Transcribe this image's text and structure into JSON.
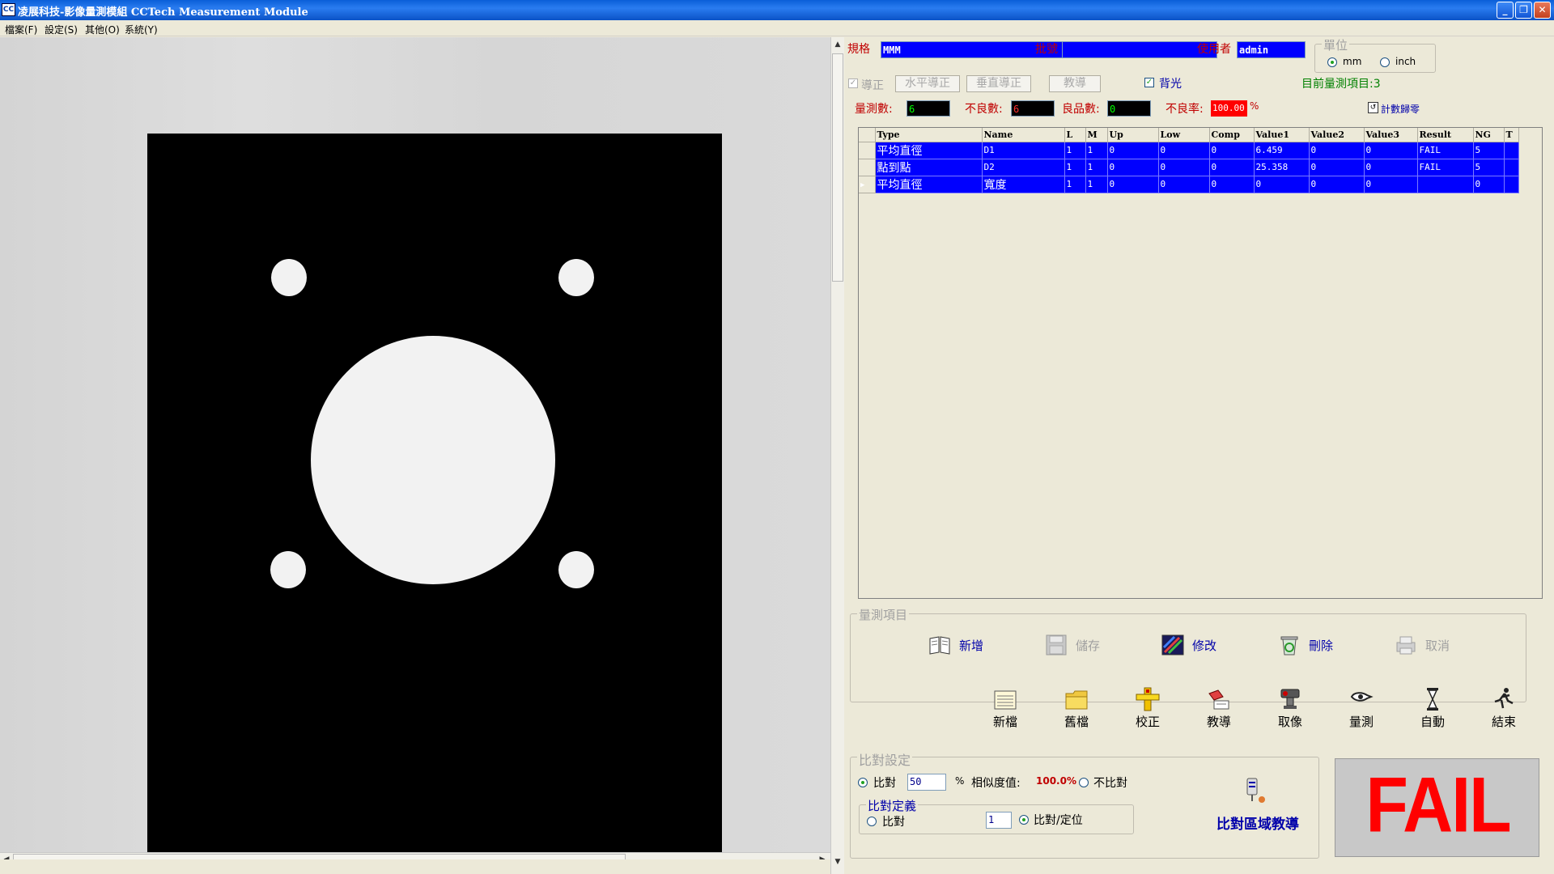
{
  "window": {
    "title": "凌展科技-影像量測模組 CCTech Measurement Module",
    "icon_text": "CC"
  },
  "menu": [
    "檔案(F)",
    "設定(S)",
    "其他(O)",
    "系統(Y)"
  ],
  "header": {
    "spec_label": "規格",
    "spec_value": "MMM",
    "batch_label": "批號",
    "batch_value": "",
    "user_label": "使用者",
    "user_value": "admin",
    "unit_group_title": "單位",
    "unit_mm": "mm",
    "unit_inch": "inch",
    "unit_selected": "mm"
  },
  "controls": {
    "guide_check_label": "導正",
    "horizontal_guide": "水平導正",
    "vertical_guide": "垂直導正",
    "teach": "教導",
    "backlight_label": "背光",
    "current_items": "目前量測項目:3"
  },
  "stats": {
    "measure_count_label": "量測數:",
    "measure_count": "6",
    "defect_count_label": "不良數:",
    "defect_count": "6",
    "good_count_label": "良品數:",
    "good_count": "0",
    "defect_rate_label": "不良率:",
    "defect_rate": "100.00",
    "percent": "%",
    "reset_label": "計數歸零"
  },
  "table": {
    "columns": [
      "Type",
      "Name",
      "L",
      "M",
      "Up",
      "Low",
      "Comp",
      "Value1",
      "Value2",
      "Value3",
      "Result",
      "NG",
      "T"
    ],
    "rows": [
      [
        "平均直徑",
        "D1",
        "1",
        "1",
        "0",
        "0",
        "0",
        "6.459",
        "0",
        "0",
        "FAIL",
        "5",
        ""
      ],
      [
        "點到點",
        "D2",
        "1",
        "1",
        "0",
        "0",
        "0",
        "25.358",
        "0",
        "0",
        "FAIL",
        "5",
        ""
      ],
      [
        "平均直徑",
        "寬度",
        "1",
        "1",
        "0",
        "0",
        "0",
        "0",
        "0",
        "0",
        "",
        "0",
        ""
      ]
    ]
  },
  "items_group": {
    "title": "量測項目",
    "add": "新增",
    "save": "儲存",
    "edit": "修改",
    "delete": "刪除",
    "cancel": "取消"
  },
  "toolbar": {
    "new_file": "新檔",
    "open_file": "舊檔",
    "calibrate": "校正",
    "teach": "教導",
    "capture": "取像",
    "measure": "量測",
    "auto": "自動",
    "exit": "結束"
  },
  "compare": {
    "group_title": "比對設定",
    "compare_label": "比對",
    "compare_value": "50",
    "percent": "%",
    "similarity_label": "相似度值:",
    "similarity_value": "100.0%",
    "no_compare_label": "不比對",
    "define_title": "比對定義",
    "define_compare": "比對",
    "define_value": "1",
    "define_compare_locate": "比對/定位",
    "region_teach": "比對區域教導"
  },
  "result": {
    "status": "FAIL",
    "status_color": "#ff0000"
  },
  "colors": {
    "field_blue": "#0000ff",
    "label_red": "#c00000",
    "title_blue": "#0a52c6"
  }
}
